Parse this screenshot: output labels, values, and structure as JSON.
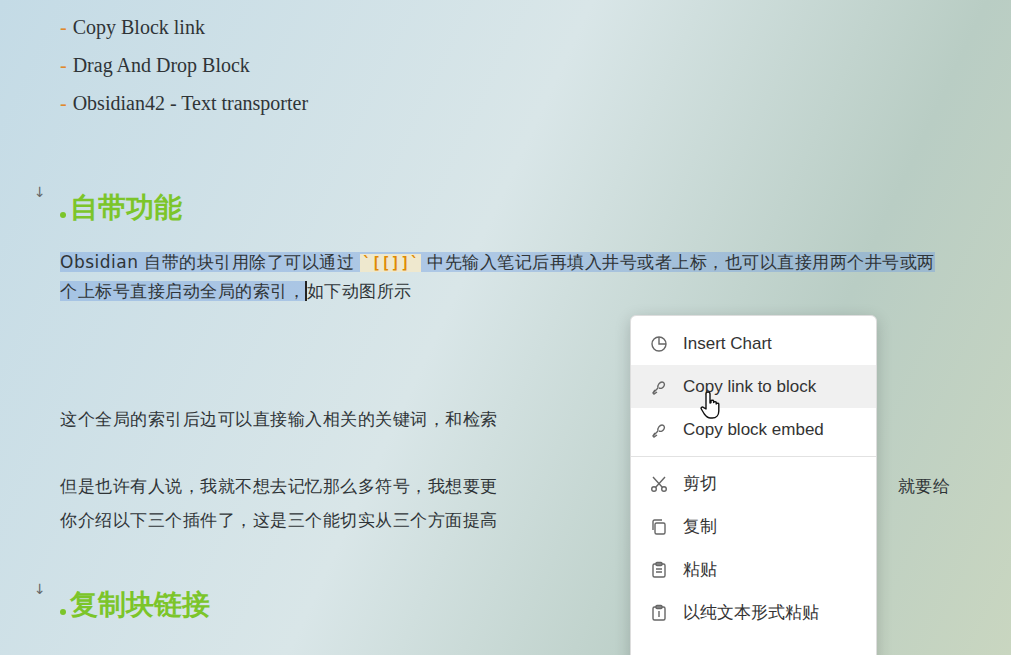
{
  "bullets": [
    {
      "mark": "-",
      "text": "Copy Block link"
    },
    {
      "mark": "-",
      "text": "Drag And Drop Block"
    },
    {
      "mark": "-",
      "text": "Obsidian42 - Text transporter"
    }
  ],
  "section1": {
    "fold_icon": "↓",
    "heading": "自带功能"
  },
  "paragraph1": {
    "selected": true,
    "cursor": true,
    "parts": [
      {
        "kind": "text",
        "text": "Obsidian 自带的块引用除了可以通过 "
      },
      {
        "kind": "code",
        "text": "`[[]]`"
      },
      {
        "kind": "text",
        "text": " 中先输入笔记后再填入井号或者上标，也可以直接用两个井号或两个上标号直接启动全局的索引，"
      }
    ],
    "after_cursor": "如下动图所示"
  },
  "paragraph2": "这个全局的索引后边可以直接输入相关的关键词，和检索",
  "paragraph3": [
    {
      "left": "但是也许有人说，我就不想去记忆那么多符号，我想要更",
      "right": "就要给"
    },
    {
      "left": "你介绍以下三个插件了，这是三个能切实从三个方面提高",
      "right": ""
    }
  ],
  "section2": {
    "fold_icon": "↓",
    "heading": "复制块链接"
  },
  "context_menu": {
    "groups": [
      [
        {
          "label": "Insert Chart",
          "hovered": false
        },
        {
          "label": "Copy link to block",
          "hovered": true
        },
        {
          "label": "Copy block embed",
          "hovered": false
        }
      ],
      [
        {
          "label": "剪切",
          "hovered": false
        },
        {
          "label": "复制",
          "hovered": false
        },
        {
          "label": "粘贴",
          "hovered": false
        },
        {
          "label": "以纯文本形式粘贴",
          "hovered": false
        }
      ]
    ]
  }
}
